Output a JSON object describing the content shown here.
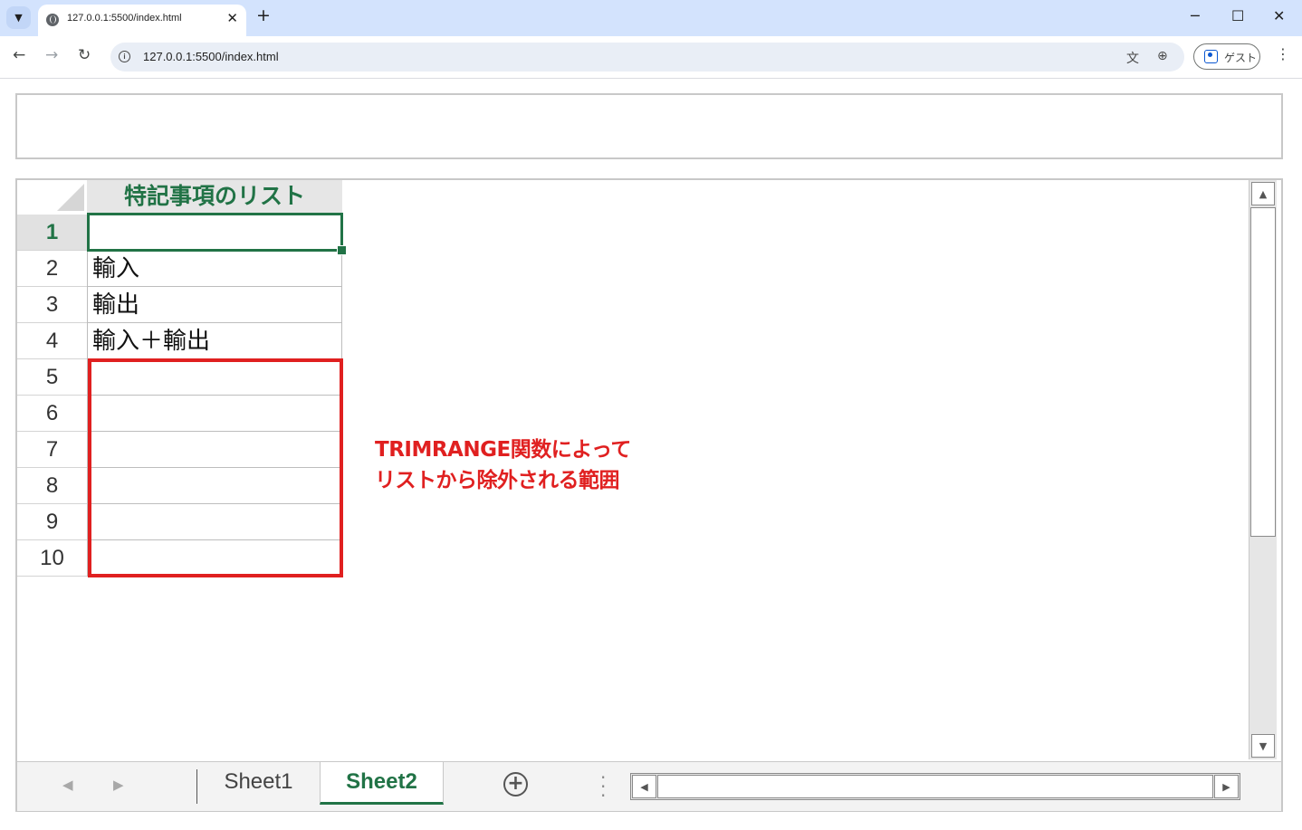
{
  "browser": {
    "tab_title": "127.0.0.1:5500/index.html",
    "url": "127.0.0.1:5500/index.html",
    "guest_label": "ゲスト",
    "tab_close": "✕",
    "new_tab": "+",
    "win_min": "─",
    "win_max": "☐",
    "win_close": "✕",
    "back": "←",
    "forward": "→",
    "reload": "↻",
    "menu": "⋮"
  },
  "spreadsheet": {
    "column_header": "特記事項のリスト",
    "rows": [
      {
        "num": "1",
        "value": ""
      },
      {
        "num": "2",
        "value": "輸入"
      },
      {
        "num": "3",
        "value": "輸出"
      },
      {
        "num": "4",
        "value": "輸入＋輸出"
      },
      {
        "num": "5",
        "value": ""
      },
      {
        "num": "6",
        "value": ""
      },
      {
        "num": "7",
        "value": ""
      },
      {
        "num": "8",
        "value": ""
      },
      {
        "num": "9",
        "value": ""
      },
      {
        "num": "10",
        "value": ""
      }
    ],
    "active_row": "1",
    "annotation": {
      "line1": "TRIMRANGE関数によって",
      "line2": "リストから除外される範囲",
      "color": "#e02020"
    },
    "sheet_tabs": [
      {
        "label": "Sheet1",
        "active": false
      },
      {
        "label": "Sheet2",
        "active": true
      }
    ],
    "accent_color": "#217346"
  }
}
